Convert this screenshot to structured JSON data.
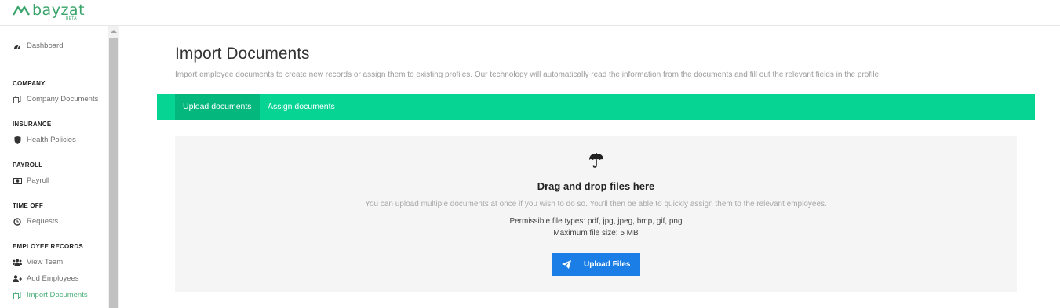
{
  "brand": {
    "name": "bayzat",
    "tag": "BETA",
    "color": "#3aa46a"
  },
  "sidebar": {
    "dashboard": {
      "label": "Dashboard",
      "icon": "dashboard-icon"
    },
    "sections": {
      "company": {
        "title": "COMPANY",
        "items": [
          {
            "label": "Company Documents",
            "icon": "documents-icon"
          }
        ]
      },
      "insurance": {
        "title": "INSURANCE",
        "items": [
          {
            "label": "Health Policies",
            "icon": "shield-icon"
          }
        ]
      },
      "payroll": {
        "title": "PAYROLL",
        "items": [
          {
            "label": "Payroll",
            "icon": "money-icon"
          }
        ]
      },
      "timeoff": {
        "title": "TIME OFF",
        "items": [
          {
            "label": "Requests",
            "icon": "clock-icon"
          }
        ]
      },
      "employee_records": {
        "title": "EMPLOYEE RECORDS",
        "items": [
          {
            "label": "View Team",
            "icon": "team-icon"
          },
          {
            "label": "Add Employees",
            "icon": "add-user-icon"
          },
          {
            "label": "Import Documents",
            "icon": "documents-icon",
            "active": true
          }
        ]
      }
    }
  },
  "main": {
    "title": "Import Documents",
    "description": "Import employee documents to create new records or assign them to existing profiles. Our technology will automatically read the information from the documents and fill out the relevant fields in the profile.",
    "tabs": [
      {
        "label": "Upload documents",
        "active": true
      },
      {
        "label": "Assign documents",
        "active": false
      }
    ],
    "dropzone": {
      "icon": "umbrella-icon",
      "title": "Drag and drop files here",
      "subtitle": "You can upload multiple documents at once if you wish to do so. You'll then be able to quickly assign them to the relevant employees.",
      "file_types": "Permissible file types: pdf, jpg, jpeg, bmp, gif, png",
      "max_size": "Maximum file size: 5 MB",
      "button_label": "Upload Files",
      "button_icon": "paper-plane-icon"
    }
  },
  "colors": {
    "accent": "#06d493",
    "accent_active": "#04b77d",
    "button": "#1a7ee6",
    "active_nav": "#4caf7a"
  }
}
